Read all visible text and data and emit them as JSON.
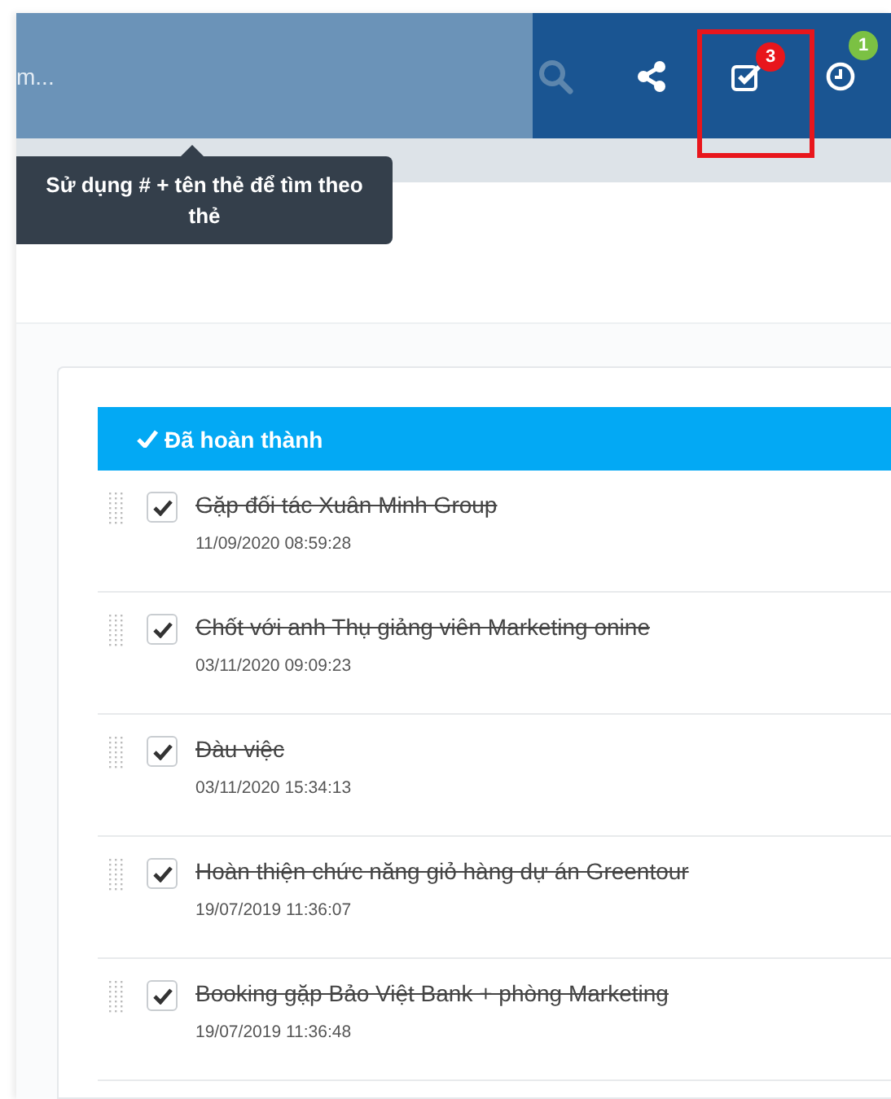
{
  "header": {
    "search": {
      "placeholder": "m..."
    },
    "tooltip": "Sử dụng # + tên thẻ để tìm theo thẻ",
    "actions": [
      {
        "kind": "search"
      },
      {
        "kind": "share"
      },
      {
        "kind": "tasks",
        "badge": "3",
        "color": "#e8161c",
        "highlighted": true
      },
      {
        "kind": "history",
        "badge": "1",
        "color": "#7bc143",
        "highlighted": false
      }
    ]
  },
  "group": {
    "title": "Đã hoàn thành",
    "tasks": [
      {
        "title": "Gặp đối tác Xuân Minh Group",
        "time": "11/09/2020 08:59:28",
        "checked": true
      },
      {
        "title": "Chốt với anh Thụ giảng viên Marketing onine",
        "time": "03/11/2020 09:09:23",
        "checked": true
      },
      {
        "title": "Đàu việc",
        "time": "03/11/2020 15:34:13",
        "checked": true
      },
      {
        "title": "Hoàn thiện chức năng giỏ hàng dự án Greentour",
        "time": "19/07/2019 11:36:07",
        "checked": true
      },
      {
        "title": "Booking gặp Bảo Việt Bank + phòng Marketing",
        "time": "19/07/2019 11:36:48",
        "checked": true
      }
    ]
  }
}
